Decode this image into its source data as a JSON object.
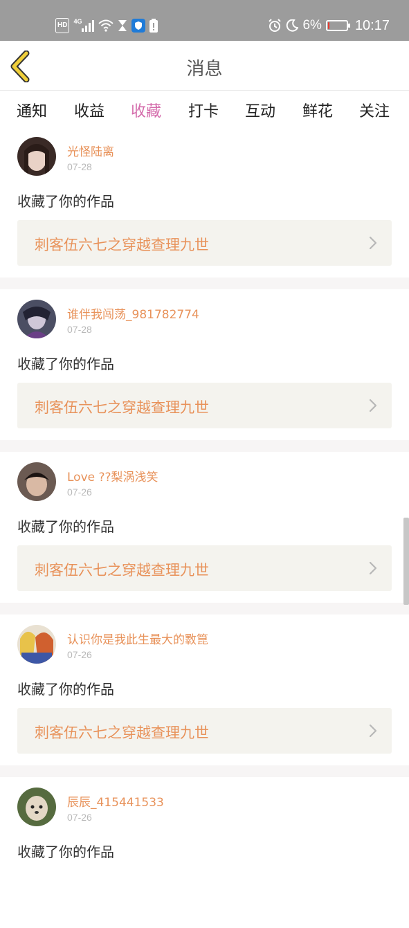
{
  "status_bar": {
    "hd": "HD",
    "signal_type": "4G",
    "battery_percent": "6%",
    "battery_level": 0.06,
    "time": "10:17",
    "icons": [
      "hd-icon",
      "signal-icon",
      "wifi-icon",
      "hourglass-icon",
      "shield-icon",
      "battery-alert-icon",
      "alarm-icon",
      "moon-icon",
      "battery-icon"
    ]
  },
  "header": {
    "title": "消息",
    "back_icon": "back-chevron-icon"
  },
  "tabs": [
    {
      "label": "通知"
    },
    {
      "label": "收益"
    },
    {
      "label": "收藏",
      "active": true
    },
    {
      "label": "打卡"
    },
    {
      "label": "互动"
    },
    {
      "label": "鲜花"
    },
    {
      "label": "关注"
    }
  ],
  "items": [
    {
      "username": "光怪陆离",
      "date": "07-28",
      "action": "收藏了你的作品",
      "work_title": "刺客伍六七之穿越查理九世"
    },
    {
      "username": "谁伴我闯荡_981782774",
      "date": "07-28",
      "action": "收藏了你的作品",
      "work_title": "刺客伍六七之穿越查理九世"
    },
    {
      "username": "Love ??梨涡浅笑",
      "date": "07-26",
      "action": "收藏了你的作品",
      "work_title": "刺客伍六七之穿越查理九世"
    },
    {
      "username": "认识你是我此生最大的斁箟",
      "date": "07-26",
      "action": "收藏了你的作品",
      "work_title": "刺客伍六七之穿越查理九世"
    },
    {
      "username": "辰辰_415441533",
      "date": "07-26",
      "action": "收藏了你的作品",
      "work_title": ""
    }
  ],
  "colors": {
    "accent_tab": "#d46bab",
    "username": "#e8925a",
    "card_bg": "#f4f3ee",
    "status_bar": "#9c9c9c"
  }
}
